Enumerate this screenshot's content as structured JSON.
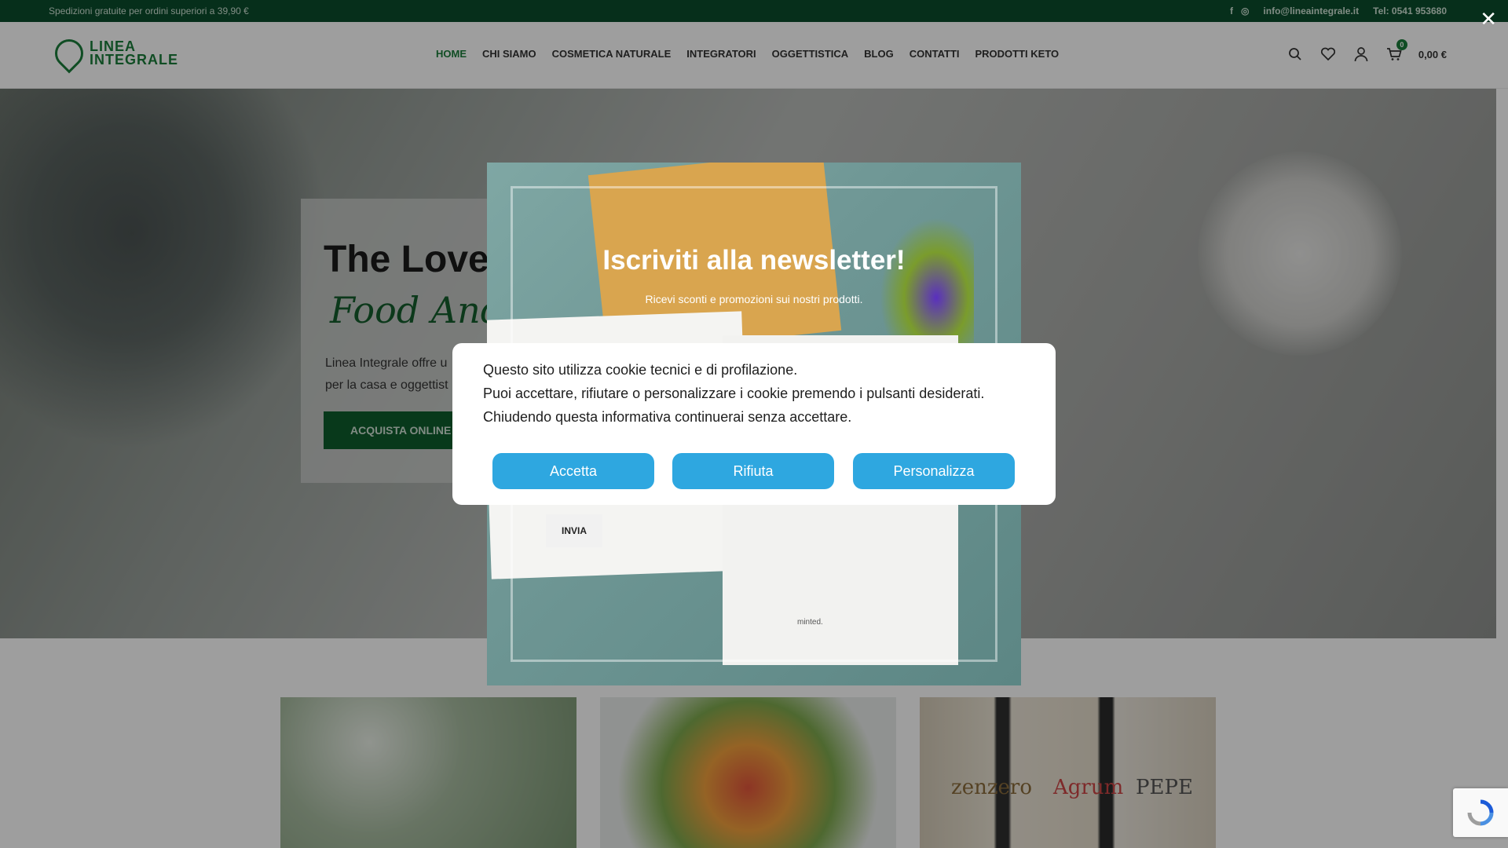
{
  "topbar": {
    "shipping_text": "Spedizioni gratuite per ordini superiori a 39,90 €",
    "email": "info@lineaintegrale.it",
    "phone": "Tel: 0541 953680",
    "social_icons": [
      "facebook-icon",
      "instagram-icon"
    ]
  },
  "header": {
    "logo_line1": "LINEA",
    "logo_line2": "INTEGRALE",
    "nav": [
      "HOME",
      "CHI SIAMO",
      "COSMETICA NATURALE",
      "INTEGRATORI",
      "OGGETTISTICA",
      "BLOG",
      "CONTATTI",
      "PRODOTTI KETO"
    ],
    "cart_count": "0",
    "cart_total": "0,00 €"
  },
  "hero": {
    "title": "The Love",
    "script": "Food And",
    "desc_line1": "Linea Integrale offre u",
    "desc_line2": "per la casa e oggettist",
    "cta": "ACQUISTA ONLINE"
  },
  "tiles": {
    "tile3_labels": [
      "zenzero",
      "Agrum",
      "PEPE"
    ]
  },
  "newsletter": {
    "title": "Iscriviti alla newsletter!",
    "subtitle": "Ricevi sconti e promozioni sui nostri prodotti.",
    "submit": "INVIA",
    "envelope_brand": "minted."
  },
  "cookie": {
    "line1": "Questo sito utilizza cookie tecnici e di profilazione.",
    "line2": "Puoi accettare, rifiutare o personalizzare i cookie premendo i pulsanti desiderati.",
    "line3": "Chiudendo questa informativa continuerai senza accettare.",
    "accept": "Accetta",
    "reject": "Rifiuta",
    "customize": "Personalizza",
    "button_color": "#2ea7e0"
  },
  "colors": {
    "brand_green": "#1a7d3a",
    "topbar_green": "#0b4d2c"
  }
}
